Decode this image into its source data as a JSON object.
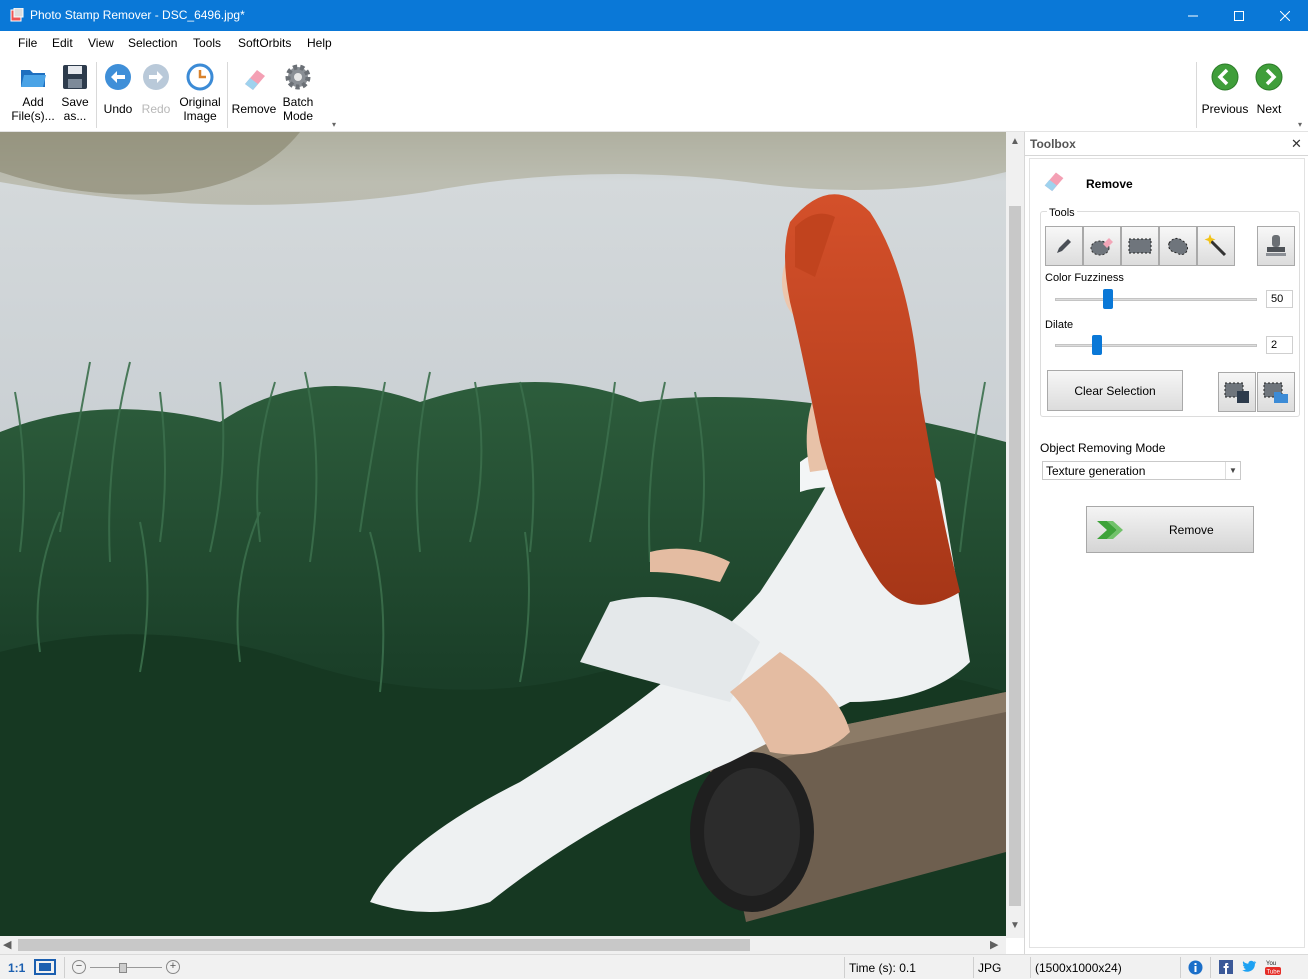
{
  "window": {
    "title": "Photo Stamp Remover - DSC_6496.jpg*",
    "min_icon": "minimize-icon",
    "max_icon": "maximize-icon",
    "close_icon": "close-icon"
  },
  "menu": {
    "items": [
      "File",
      "Edit",
      "View",
      "Selection",
      "Tools",
      "SoftOrbits",
      "Help"
    ]
  },
  "toolbar": {
    "add_files": [
      "Add",
      "File(s)..."
    ],
    "save_as": [
      "Save",
      "as..."
    ],
    "undo": "Undo",
    "redo": "Redo",
    "original_image": [
      "Original",
      "Image"
    ],
    "remove": "Remove",
    "batch_mode": [
      "Batch",
      "Mode"
    ],
    "previous": "Previous",
    "next": "Next"
  },
  "toolbox": {
    "header": "Toolbox",
    "section_title": "Remove",
    "tools_group": "Tools",
    "tool_icons": [
      "pencil-icon",
      "eraser-icon",
      "rect-select-icon",
      "lasso-icon",
      "magic-wand-icon",
      "stamp-icon"
    ],
    "color_fuzziness_label": "Color Fuzziness",
    "color_fuzziness_value": "50",
    "color_fuzziness_fraction": 0.26,
    "dilate_label": "Dilate",
    "dilate_value": "2",
    "dilate_fraction": 0.21,
    "clear_selection": "Clear Selection",
    "mode_label": "Object Removing Mode",
    "mode_value": "Texture generation",
    "remove_button": "Remove"
  },
  "statusbar": {
    "zoom_ratio": "1:1",
    "time": "Time (s): 0.1",
    "format": "JPG",
    "dimensions": "(1500x1000x24)"
  },
  "colors": {
    "titlebar": "#0a78d7",
    "accent": "#0a78d7",
    "hair": "#c8461c",
    "dress": "#f2f4f5",
    "grass": "#1f4d30",
    "water": "#d8dde0"
  }
}
